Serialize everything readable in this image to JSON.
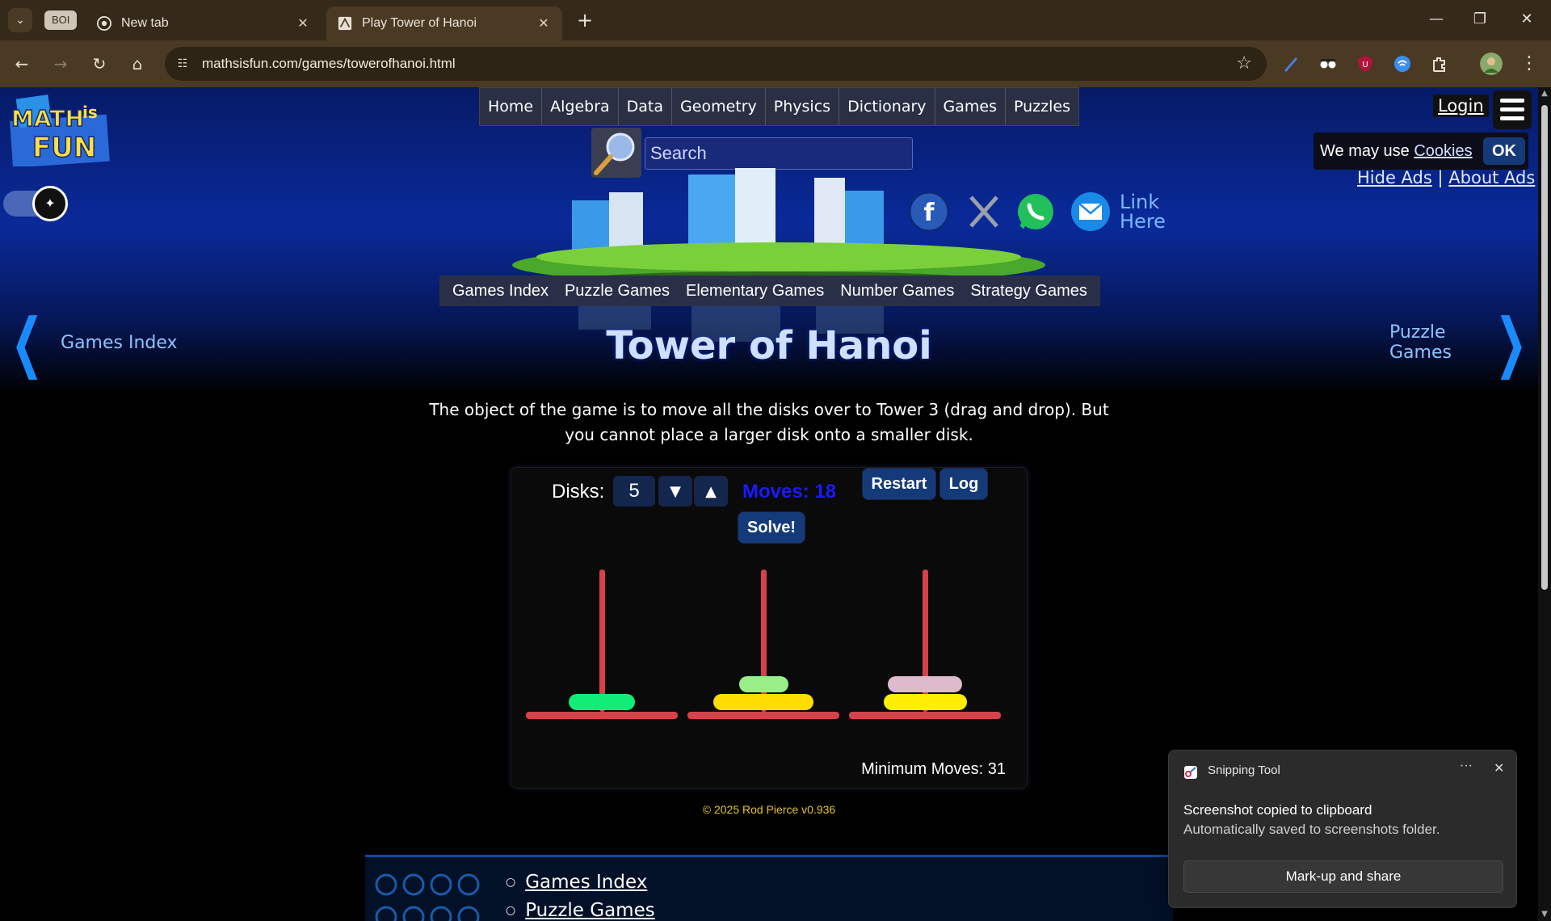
{
  "browser": {
    "tab_group_label": "BOI",
    "tabs": [
      {
        "title": "New tab",
        "active": false
      },
      {
        "title": "Play Tower of Hanoi",
        "active": true
      }
    ],
    "new_tab_glyph": "+",
    "url": "mathsisfun.com/games/towerofhanoi.html",
    "window_controls": [
      "minimize-icon",
      "restore-icon",
      "close-icon"
    ]
  },
  "header": {
    "logo_text": [
      "MATH",
      "is",
      "FUN"
    ],
    "menu": [
      "Home",
      "Algebra",
      "Data",
      "Geometry",
      "Physics",
      "Dictionary",
      "Games",
      "Puzzles"
    ],
    "login": "Login",
    "search_placeholder": "Search",
    "cookie": {
      "text": "We may use ",
      "link": "Cookies",
      "ok": "OK"
    },
    "ads": {
      "hide": "Hide Ads",
      "separator": "|",
      "about": "About Ads"
    },
    "link_here": [
      "Link",
      "Here"
    ],
    "social_icons": [
      "facebook-icon",
      "x-icon",
      "whatsapp-icon",
      "email-icon"
    ]
  },
  "sub_menu": [
    "Games Index",
    "Puzzle Games",
    "Elementary Games",
    "Number Games",
    "Strategy Games"
  ],
  "pager": {
    "prev": "Games Index",
    "next": "Puzzle Games"
  },
  "title": "Tower of Hanoi",
  "intro": "The object of the game is to move all the disks over to Tower 3 (drag and drop). But you cannot place a larger disk onto a smaller disk.",
  "game": {
    "disks_label": "Disks:",
    "disks_value": "5",
    "down_glyph": "▼",
    "up_glyph": "▲",
    "moves_text": "Moves: 18",
    "restart": "Restart",
    "log": "Log",
    "solve": "Solve!",
    "min_moves_text": "Minimum Moves: 31",
    "towers": [
      {
        "disks": [
          {
            "size": 2,
            "color": "#11ee77"
          }
        ]
      },
      {
        "disks": [
          {
            "size": 4,
            "color": "#ffdd00"
          },
          {
            "size": 1,
            "color": "#99ee88"
          }
        ]
      },
      {
        "disks": [
          {
            "size": 3,
            "color": "#ffee00"
          },
          {
            "size": 2.5,
            "color": "#ddbbcc"
          }
        ]
      }
    ],
    "colors": {
      "pole": "#d8404c",
      "moves": "#1a1aff",
      "button": "#153a7a"
    }
  },
  "copyright": "© 2025 Rod Pierce v0.936",
  "footer_links": [
    "Games Index",
    "Puzzle Games"
  ],
  "toast": {
    "app": "Snipping Tool",
    "more": "···",
    "headline": "Screenshot copied to clipboard",
    "body": "Automatically saved to screenshots folder.",
    "action": "Mark-up and share"
  }
}
